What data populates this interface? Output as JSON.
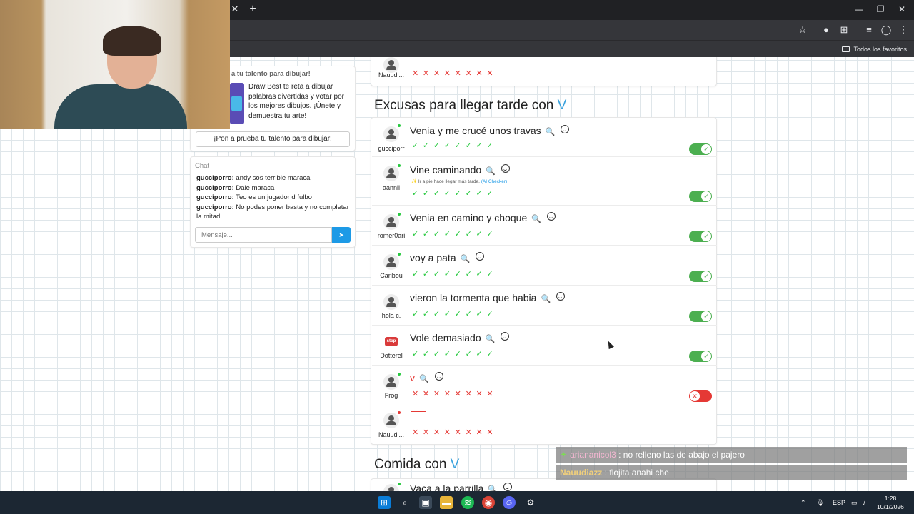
{
  "browser": {
    "bookmarks_label": "Todos los favoritos"
  },
  "promo": {
    "title": "a tu talento para dibujar!",
    "text": "Draw Best te reta a dibujar palabras divertidas y votar por los mejores dibujos. ¡Únete y demuestra tu arte!",
    "button": "¡Pon a prueba tu talento para dibujar!"
  },
  "chat": {
    "title": "Chat",
    "messages": [
      {
        "user": "gucciporro:",
        "text": "andy sos terrible maraca"
      },
      {
        "user": "gucciporro:",
        "text": "Dale maraca"
      },
      {
        "user": "gucciporro:",
        "text": "Teo es un jugador d fulbo"
      },
      {
        "user": "gucciporro:",
        "text": "No podes poner basta y no completar la mitad"
      }
    ],
    "input_placeholder": "Mensaje..."
  },
  "top_row": {
    "user": "Nauudi...",
    "marks": "✕✕✕✕✕✕✕✕"
  },
  "section1": {
    "title": "Excusas para llegar tarde con",
    "letter": "V",
    "rows": [
      {
        "user": "gucciporr",
        "answer": "Venia y me crucé unos travas",
        "marks": "✓✓✓✓✓✓✓✓",
        "valid": true
      },
      {
        "user": "aannii",
        "answer": "Vine caminando",
        "note": "Ir a pie hace llegar más tarde.",
        "note_tag": "(AI Checker)",
        "marks": "✓✓✓✓✓✓✓✓",
        "valid": true
      },
      {
        "user": "romer0ari",
        "answer": "Venia en camino y choque",
        "marks": "✓✓✓✓✓✓✓✓",
        "valid": true
      },
      {
        "user": "Caribou",
        "answer": "voy a pata",
        "marks": "✓✓✓✓✓✓✓✓",
        "valid": true
      },
      {
        "user": "hola c.",
        "answer": "vieron la tormenta que habia",
        "marks": "✓✓✓✓✓✓✓✓",
        "valid": true
      },
      {
        "user": "Dotterel",
        "answer": "Vole demasiado",
        "marks": "✓✓✓✓✓✓✓✓",
        "valid": true
      },
      {
        "user": "Frog",
        "answer": "v",
        "marks": "✕✕✕✕✕✕✕✕",
        "valid": false
      },
      {
        "user": "Nauudi...",
        "answer": "",
        "marks": "✕✕✕✕✕✕✕✕",
        "valid": false
      }
    ]
  },
  "section2": {
    "title": "Comida con",
    "letter": "V",
    "first_answer": "Vaca a la parrilla"
  },
  "stream_chat": [
    {
      "user": "ariananicol3",
      "text": ": no relleno las de abajo el pajero"
    },
    {
      "user": "Nauudiazz",
      "text": ": flojita anahi che"
    }
  ],
  "taskbar": {
    "lang": "ESP",
    "time": "1:28",
    "date": "10/1/2026"
  },
  "colors": {
    "accent": "#1d9ae6",
    "ok": "#27c93f",
    "error": "#e53935",
    "toggle_on": "#4caf50"
  }
}
